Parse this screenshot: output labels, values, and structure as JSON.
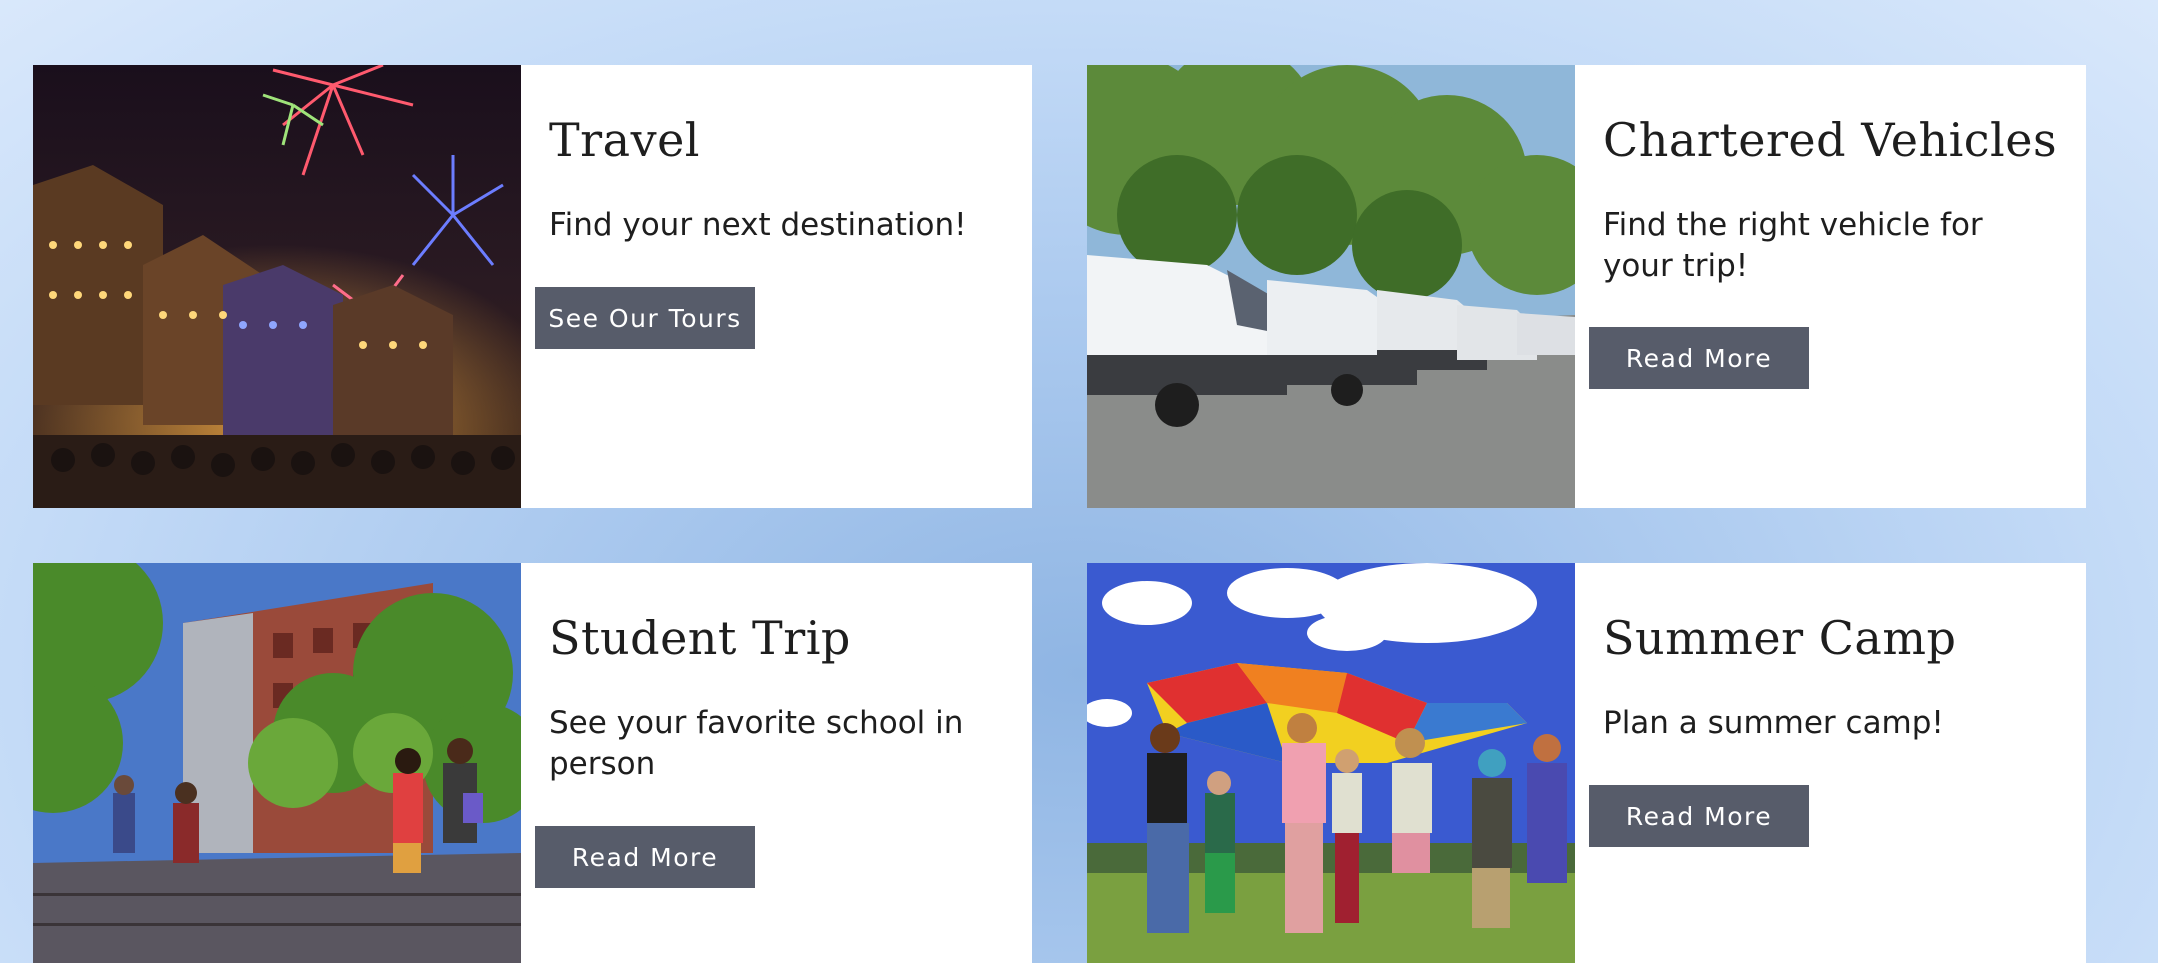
{
  "cards": [
    {
      "title": "Travel",
      "text": "Find your next destination!",
      "button": "See Our Tours",
      "image_icon": "festival-fireworks-image"
    },
    {
      "title": "Chartered Vehicles",
      "text": "Find the right vehicle for your trip!",
      "button": "Read More",
      "image_icon": "white-vans-parked-image"
    },
    {
      "title": "Student Trip",
      "text": "See your favorite school in person",
      "button": "Read More",
      "image_icon": "campus-students-walking-image"
    },
    {
      "title": "Summer Camp",
      "text": "Plan a summer camp!",
      "button": "Read More",
      "image_icon": "kids-parachute-game-image"
    }
  ],
  "colors": {
    "button_bg": "#575c6a",
    "card_bg": "#ffffff",
    "text": "#1e1e1e"
  }
}
